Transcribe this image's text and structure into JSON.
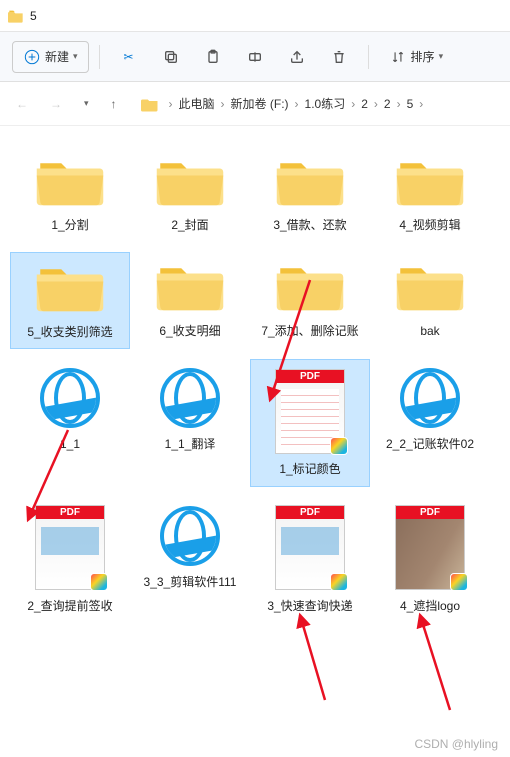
{
  "window": {
    "title": "5"
  },
  "toolbar": {
    "new_label": "新建",
    "sort_label": "排序"
  },
  "breadcrumb": {
    "items": [
      "此电脑",
      "新加卷 (F:)",
      "1.0练习",
      "2",
      "2",
      "5"
    ]
  },
  "items": [
    {
      "label": "1_分割",
      "type": "folder",
      "selected": false
    },
    {
      "label": "2_封面",
      "type": "folder",
      "selected": false
    },
    {
      "label": "3_借款、还款",
      "type": "folder",
      "selected": false
    },
    {
      "label": "4_视频剪辑",
      "type": "folder",
      "selected": false
    },
    {
      "label": "5_收支类别筛选",
      "type": "folder",
      "selected": true
    },
    {
      "label": "6_收支明细",
      "type": "folder",
      "selected": false
    },
    {
      "label": "7_添加、删除记账",
      "type": "folder",
      "selected": false
    },
    {
      "label": "bak",
      "type": "folder",
      "selected": false
    },
    {
      "label": "1_1",
      "type": "ie",
      "selected": false
    },
    {
      "label": "1_1_翻译",
      "type": "ie",
      "selected": false
    },
    {
      "label": "1_标记颜色",
      "type": "pdf",
      "variant": "redline",
      "selected": true
    },
    {
      "label": "2_2_记账软件02",
      "type": "ie",
      "selected": false
    },
    {
      "label": "2_查询提前签收",
      "type": "pdf",
      "variant": "blueish",
      "selected": false
    },
    {
      "label": "3_3_剪辑软件111",
      "type": "ie",
      "selected": false
    },
    {
      "label": "3_快速查询快递",
      "type": "pdf",
      "variant": "blueish",
      "selected": false
    },
    {
      "label": "4_遮挡logo",
      "type": "pdf",
      "variant": "photo",
      "selected": false
    }
  ],
  "pdf_badge": "PDF",
  "watermark": "CSDN @hlyling"
}
